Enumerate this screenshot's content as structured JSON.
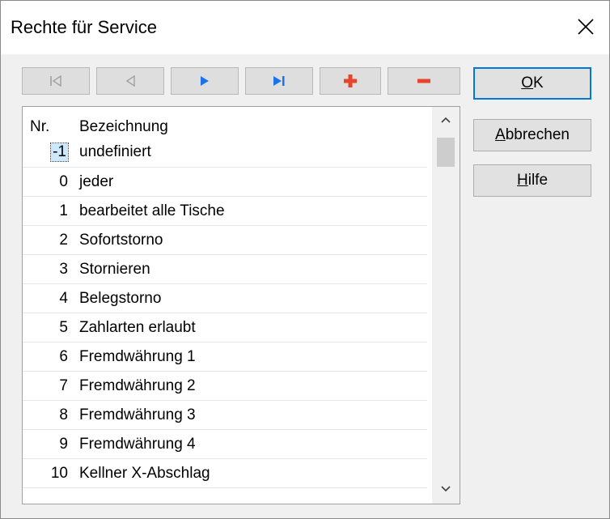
{
  "window": {
    "title": "Rechte für Service"
  },
  "navigator": {
    "buttons": [
      {
        "name": "first",
        "enabled": false
      },
      {
        "name": "prior",
        "enabled": false
      },
      {
        "name": "next",
        "enabled": true
      },
      {
        "name": "last",
        "enabled": true
      },
      {
        "name": "insert",
        "enabled": true
      },
      {
        "name": "delete",
        "enabled": true
      }
    ],
    "colors": {
      "disabled": "#9a9a9a",
      "nav_arrow": "#1a73e8",
      "insert": "#e8442c",
      "delete": "#e8442c"
    }
  },
  "list": {
    "header": {
      "nr": "Nr.",
      "bezeichnung": "Bezeichnung"
    },
    "rows": [
      {
        "nr": "-1",
        "bezeichnung": "undefiniert"
      },
      {
        "nr": "0",
        "bezeichnung": "jeder"
      },
      {
        "nr": "1",
        "bezeichnung": "bearbeitet alle Tische"
      },
      {
        "nr": "2",
        "bezeichnung": "Sofortstorno"
      },
      {
        "nr": "3",
        "bezeichnung": "Stornieren"
      },
      {
        "nr": "4",
        "bezeichnung": "Belegstorno"
      },
      {
        "nr": "5",
        "bezeichnung": "Zahlarten erlaubt"
      },
      {
        "nr": "6",
        "bezeichnung": "Fremdwährung 1"
      },
      {
        "nr": "7",
        "bezeichnung": "Fremdwährung 2"
      },
      {
        "nr": "8",
        "bezeichnung": "Fremdwährung 3"
      },
      {
        "nr": "9",
        "bezeichnung": "Fremdwährung 4"
      },
      {
        "nr": "10",
        "bezeichnung": "Kellner X-Abschlag"
      }
    ],
    "selected_index": 0
  },
  "buttons": {
    "ok": {
      "mnemonic": "O",
      "rest": "K"
    },
    "cancel": {
      "mnemonic": "A",
      "rest": "bbrechen"
    },
    "help": {
      "mnemonic": "H",
      "rest": "ilfe"
    }
  }
}
